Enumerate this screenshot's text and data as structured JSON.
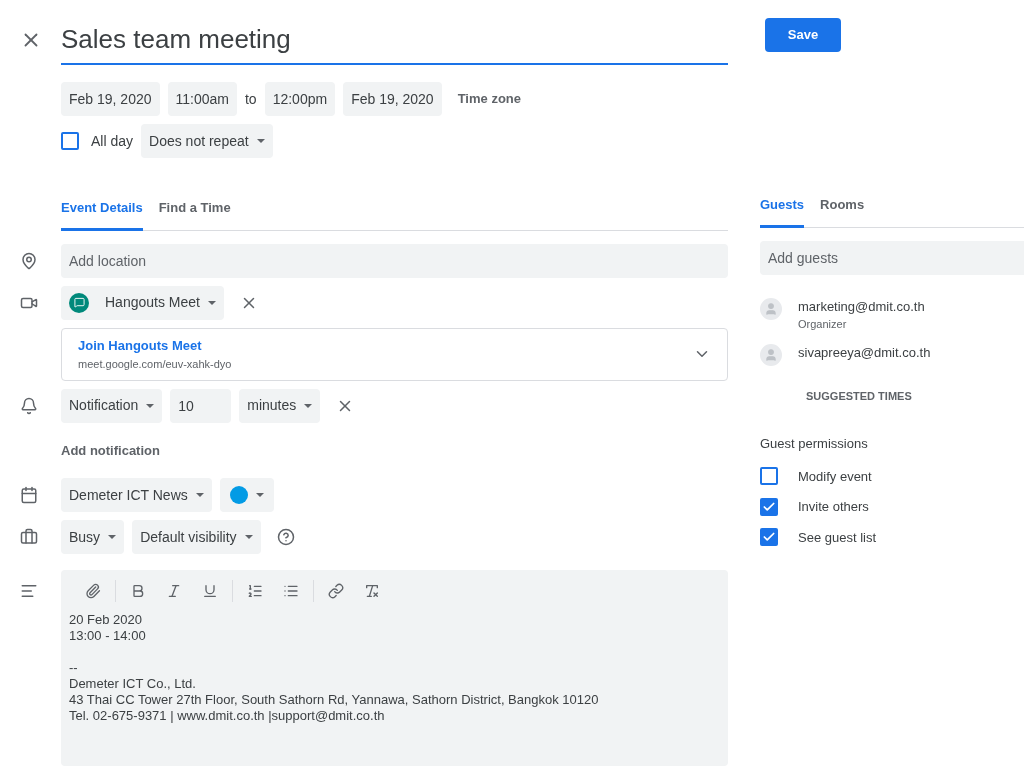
{
  "title": "Sales team meeting",
  "save_button": "Save",
  "schedule": {
    "start_date": "Feb 19, 2020",
    "start_time": "11:00am",
    "separator": "to",
    "end_time": "12:00pm",
    "end_date": "Feb 19, 2020",
    "time_zone": "Time zone"
  },
  "all_day": {
    "label": "All day",
    "checked": false
  },
  "repeat": "Does not repeat",
  "tabs": [
    {
      "label": "Event Details",
      "selected": true
    },
    {
      "label": "Find a Time",
      "selected": false
    }
  ],
  "location": {
    "placeholder": "Add location"
  },
  "conference": {
    "provider": "Hangouts Meet",
    "join_label": "Join Hangouts Meet",
    "url": "meet.google.com/euv-xahk-dyo"
  },
  "notification": {
    "type": "Notification",
    "value": "10",
    "unit": "minutes"
  },
  "add_notification": "Add notification",
  "calendar": {
    "name": "Demeter ICT News",
    "color": "#039be5"
  },
  "availability": "Busy",
  "visibility": "Default visibility",
  "description": {
    "blocks": [
      [
        "20 Feb 2020",
        "13:00 - 14:00"
      ],
      [
        "--",
        "Demeter ICT Co., Ltd.",
        "43 Thai CC Tower 27th Floor, South Sathorn Rd, Yannawa, Sathorn District, Bangkok 10120",
        "Tel. 02-675-9371 | www.dmit.co.th |support@dmit.co.th"
      ]
    ]
  },
  "side_tabs": [
    {
      "label": "Guests",
      "selected": true
    },
    {
      "label": "Rooms",
      "selected": false
    }
  ],
  "guest_field": {
    "placeholder": "Add guests"
  },
  "guests": [
    {
      "email": "marketing@dmit.co.th",
      "role": "Organizer"
    },
    {
      "email": "sivapreeya@dmit.co.th"
    }
  ],
  "suggested_times": "SUGGESTED TIMES",
  "permissions_title": "Guest permissions",
  "permissions": [
    {
      "label": "Modify event",
      "checked": false
    },
    {
      "label": "Invite others",
      "checked": true
    },
    {
      "label": "See guest list",
      "checked": true
    }
  ]
}
